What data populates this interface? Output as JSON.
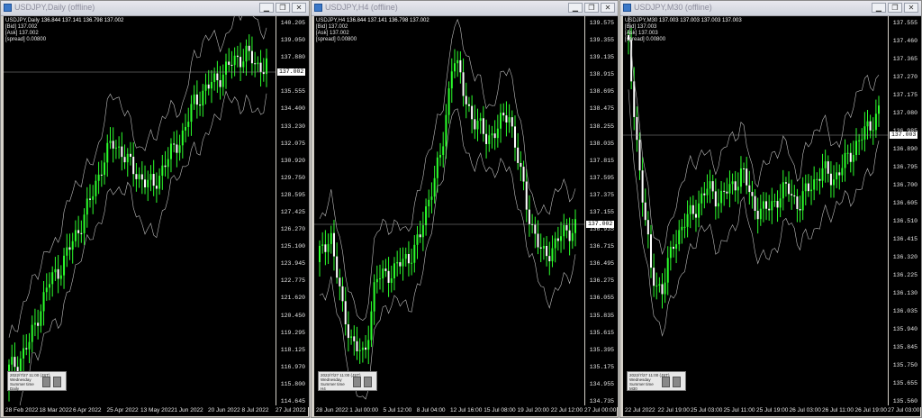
{
  "windows": [
    {
      "title": "USDJPY,Daily (offline)",
      "info_symbol": "USDJPY,Daily",
      "ohlc": "136.844 137.141 136.798 137.002",
      "info_lines": [
        "[Bid] 137.002",
        "[Ask] 137.002",
        "[spread] 0.00800"
      ],
      "current_price": "137.002",
      "price_ticks": [
        "140.205",
        "139.050",
        "137.880",
        "136.725",
        "135.555",
        "134.400",
        "133.230",
        "132.075",
        "130.920",
        "129.750",
        "128.595",
        "127.425",
        "126.270",
        "125.100",
        "123.945",
        "122.775",
        "121.620",
        "120.450",
        "119.295",
        "118.125",
        "116.970",
        "115.800",
        "114.645"
      ],
      "time_ticks": [
        "28 Feb 2022",
        "18 Mar 2022",
        "6 Apr 2022",
        "25 Apr 2022",
        "13 May 2022",
        "1 Jun 2022",
        "20 Jun 2022",
        "8 Jul 2022",
        "27 Jul 2022"
      ],
      "hud_lines": [
        "2022/7/27 11:00 (JST)",
        "Wednesday",
        "Summer time",
        "Daily"
      ]
    },
    {
      "title": "USDJPY,H4 (offline)",
      "info_symbol": "USDJPY,H4",
      "ohlc": "136.844 137.141 136.798 137.002",
      "info_lines": [
        "[Bid] 137.002",
        "[Ask] 137.002",
        "[spread] 0.00800"
      ],
      "current_price": "137.002",
      "price_ticks": [
        "139.575",
        "139.355",
        "139.135",
        "138.915",
        "138.695",
        "138.475",
        "138.255",
        "138.035",
        "137.815",
        "137.595",
        "137.375",
        "137.155",
        "136.935",
        "136.715",
        "136.495",
        "136.275",
        "136.055",
        "135.835",
        "135.615",
        "135.395",
        "135.175",
        "134.955",
        "134.735"
      ],
      "time_ticks": [
        "28 Jun 2022",
        "1 Jul 00:00",
        "5 Jul 12:00",
        "8 Jul 04:00",
        "12 Jul 16:00",
        "15 Jul 08:00",
        "19 Jul 20:00",
        "22 Jul 12:00",
        "27 Jul 00:00"
      ],
      "hud_lines": [
        "2022/7/27 11:00 (JST)",
        "Wednesday",
        "Summer time",
        "H4"
      ]
    },
    {
      "title": "USDJPY,M30 (offline)",
      "info_symbol": "USDJPY,M30",
      "ohlc": "137.003 137.003 137.003 137.003",
      "info_lines": [
        "[Bid] 137.003",
        "[Ask] 137.003",
        "[spread] 0.00800"
      ],
      "current_price": "137.003",
      "price_ticks": [
        "137.555",
        "137.460",
        "137.365",
        "137.270",
        "137.175",
        "137.080",
        "136.985",
        "136.890",
        "136.795",
        "136.700",
        "136.605",
        "136.510",
        "136.415",
        "136.320",
        "136.225",
        "136.130",
        "136.035",
        "135.940",
        "135.845",
        "135.750",
        "135.655",
        "135.560"
      ],
      "time_ticks": [
        "22 Jul 2022",
        "22 Jul 19:00",
        "25 Jul 03:00",
        "25 Jul 11:00",
        "25 Jul 19:00",
        "26 Jul 03:00",
        "26 Jul 11:00",
        "26 Jul 19:00",
        "27 Jul 03:00"
      ],
      "hud_lines": [
        "2022/7/27 11:00 (JST)",
        "Wednesday",
        "Summer time",
        "M30"
      ]
    }
  ],
  "colors": {
    "bull": "#2cff2c",
    "bear": "#ffffff",
    "band": "#bdbdbd",
    "bg": "#000000"
  }
}
